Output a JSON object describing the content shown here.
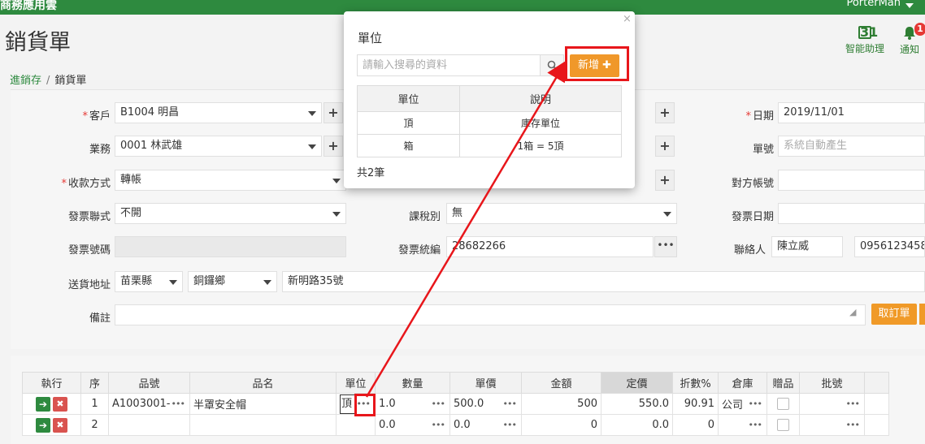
{
  "header": {
    "app_name": "商務應用雲",
    "user_name": "PorterMan",
    "page_title": "銷貨單",
    "assistant_label": "智能助理",
    "assistant_icon": "calendar-icon",
    "notify_label": "通知",
    "notify_icon": "bell-icon",
    "notify_count": "1",
    "calendar_day": "31"
  },
  "breadcrumb": {
    "parent": "進銷存",
    "sep": "/",
    "current": "銷貨單"
  },
  "form": {
    "customer_label": "客戶",
    "customer_value": "B1004 明昌",
    "sales_label": "業務",
    "sales_value": "0001 林武雄",
    "payment_label": "收款方式",
    "payment_value": "轉帳",
    "invoice_type_label": "發票聯式",
    "invoice_type_value": "不開",
    "tax_label": "課稅別",
    "tax_value": "無",
    "invoice_no_label": "發票號碼",
    "invoice_no_value": "",
    "tax_id_label": "發票統編",
    "tax_id_value": "28682266",
    "address_label": "送貨地址",
    "county_value": "苗栗縣",
    "township_value": "銅鑼鄉",
    "street_value": "新明路35號",
    "note_label": "備註",
    "note_value": "",
    "date_label": "日期",
    "date_value": "2019/11/01",
    "order_no_label": "單號",
    "order_no_placeholder": "系統自動產生",
    "account_label": "對方帳號",
    "account_value": "",
    "invoice_date_label": "發票日期",
    "invoice_date_value": "",
    "contact_label": "聯絡人",
    "contact_name": "陳立威",
    "contact_phone": "0956123458",
    "order_button": "取訂單"
  },
  "grid": {
    "headers": [
      "執行",
      "序",
      "品號",
      "品名",
      "單位",
      "數量",
      "單價",
      "金額",
      "定價",
      "折數%",
      "倉庫",
      "贈品",
      "批號"
    ],
    "rows": [
      {
        "seq": "1",
        "item_no": "A1003001-",
        "item_name": "半罩安全帽",
        "unit": "頂",
        "qty": "1.0",
        "price": "500.0",
        "amount": "500",
        "list_price": "550.0",
        "discount": "90.91",
        "warehouse": "公司"
      },
      {
        "seq": "2",
        "item_no": "",
        "item_name": "",
        "unit": "",
        "qty": "0.0",
        "price": "0.0",
        "amount": "0",
        "list_price": "0.0",
        "discount": "0",
        "warehouse": ""
      }
    ]
  },
  "modal": {
    "title": "單位",
    "close": "×",
    "search_placeholder": "請輸入搜尋的資料",
    "search_icon": "search-icon",
    "add_button": "新增 ✚",
    "columns": [
      "單位",
      "說明"
    ],
    "rows": [
      {
        "unit": "頂",
        "desc": "庫存單位"
      },
      {
        "unit": "箱",
        "desc": "1箱 = 5頂"
      }
    ],
    "count": "共2筆"
  },
  "colors": {
    "brand_green": "#2e8a3f",
    "accent_orange": "#f0982a",
    "annotation_red": "#e8161b"
  }
}
